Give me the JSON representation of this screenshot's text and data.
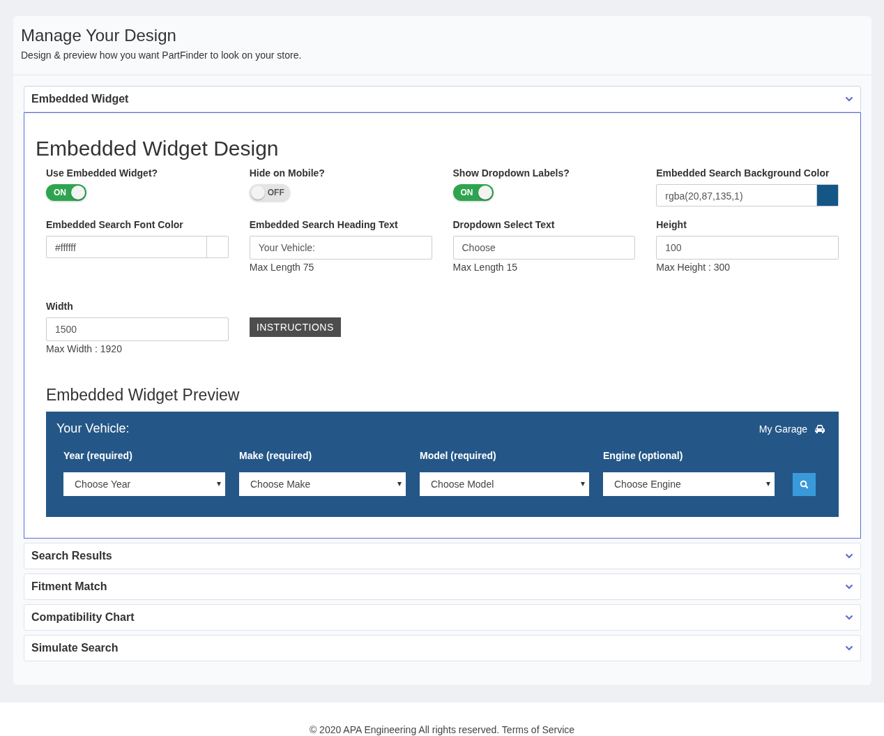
{
  "header": {
    "title": "Manage Your Design",
    "subtitle": "Design & preview how you want PartFinder to look on your store."
  },
  "sections": [
    {
      "title": "Embedded Widget",
      "expanded": true
    },
    {
      "title": "Search Results",
      "expanded": false
    },
    {
      "title": "Fitment Match",
      "expanded": false
    },
    {
      "title": "Compatibility Chart",
      "expanded": false
    },
    {
      "title": "Simulate Search",
      "expanded": false
    }
  ],
  "design": {
    "title": "Embedded Widget Design",
    "fields": [
      {
        "kind": "toggle",
        "label": "Use Embedded Widget?",
        "on": true,
        "text": "ON"
      },
      {
        "kind": "toggle",
        "label": "Hide on Mobile?",
        "on": false,
        "text": "OFF"
      },
      {
        "kind": "toggle",
        "label": "Show Dropdown Labels?",
        "on": true,
        "text": "ON"
      },
      {
        "kind": "color",
        "label": "Embedded Search Background Color",
        "value": "rgba(20,87,135,1)"
      },
      {
        "kind": "color",
        "label": "Embedded Search Font Color",
        "value": "#ffffff"
      },
      {
        "kind": "text",
        "label": "Embedded Search Heading Text",
        "value": "Your Vehicle:",
        "hint": "Max Length 75"
      },
      {
        "kind": "text",
        "label": "Dropdown Select Text",
        "value": "Choose",
        "hint": "Max Length 15"
      },
      {
        "kind": "text",
        "label": "Height",
        "value": "100",
        "hint": "Max Height : 300"
      },
      {
        "kind": "text",
        "label": "Width",
        "value": "1500",
        "hint": "Max Width : 1920"
      },
      {
        "kind": "button",
        "label": "INSTRUCTIONS"
      }
    ]
  },
  "preview": {
    "title": "Embedded Widget Preview",
    "heading": "Your Vehicle:",
    "garage": "My Garage",
    "selects": [
      {
        "label": "Year (required)",
        "value": "Choose Year"
      },
      {
        "label": "Make (required)",
        "value": "Choose Make"
      },
      {
        "label": "Model (required)",
        "value": "Choose Model"
      },
      {
        "label": "Engine (optional)",
        "value": "Choose Engine"
      }
    ]
  },
  "footer": "© 2020 APA Engineering All rights reserved. Terms of Service"
}
